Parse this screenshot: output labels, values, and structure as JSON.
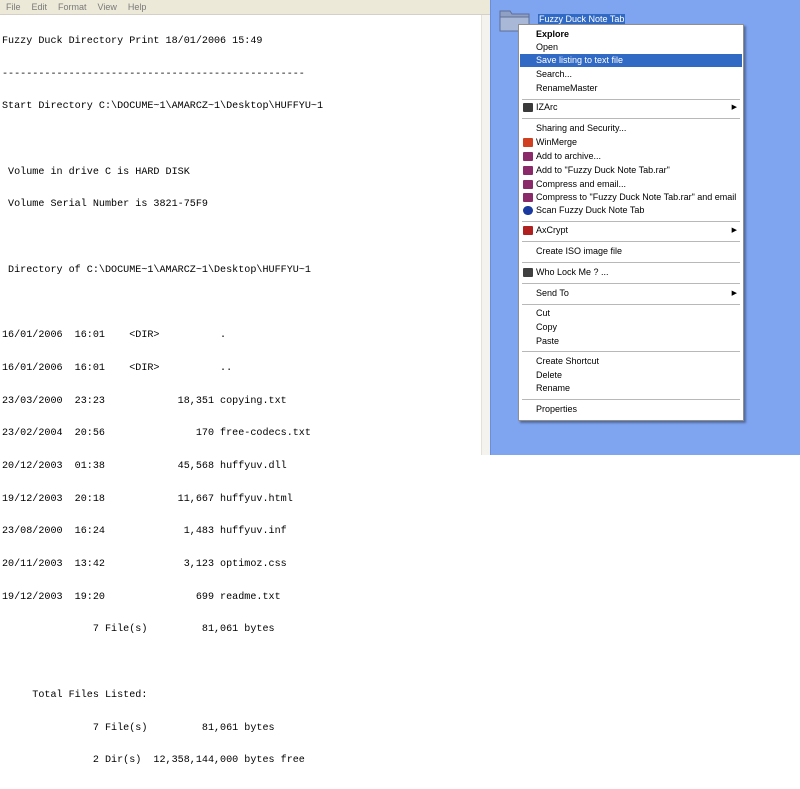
{
  "notepad": {
    "menu": [
      "File",
      "Edit",
      "Format",
      "View",
      "Help"
    ],
    "lines": [
      "Fuzzy Duck Directory Print 18/01/2006 15:49",
      "--------------------------------------------------",
      "Start Directory C:\\DOCUME~1\\AMARCZ~1\\Desktop\\HUFFYU~1",
      "",
      " Volume in drive C is HARD DISK",
      " Volume Serial Number is 3821-75F9",
      "",
      " Directory of C:\\DOCUME~1\\AMARCZ~1\\Desktop\\HUFFYU~1",
      "",
      "16/01/2006  16:01    <DIR>          .",
      "16/01/2006  16:01    <DIR>          ..",
      "23/03/2000  23:23            18,351 copying.txt",
      "23/02/2004  20:56               170 free-codecs.txt",
      "20/12/2003  01:38            45,568 huffyuv.dll",
      "19/12/2003  20:18            11,667 huffyuv.html",
      "23/08/2000  16:24             1,483 huffyuv.inf",
      "20/11/2003  13:42             3,123 optimoz.css",
      "19/12/2003  19:20               699 readme.txt",
      "               7 File(s)         81,061 bytes",
      "",
      "     Total Files Listed:",
      "               7 File(s)         81,061 bytes",
      "               2 Dir(s)  12,358,144,000 bytes free"
    ]
  },
  "desktop": {
    "folder_label": "Fuzzy Duck Note Tab"
  },
  "context_menu": {
    "explore": "Explore",
    "open": "Open",
    "save_listing": "Save listing to text file",
    "search": "Search...",
    "renamemaster": "RenameMaster",
    "izarc": "IZArc",
    "sharing": "Sharing and Security...",
    "winmerge": "WinMerge",
    "add_archive": "Add to archive...",
    "add_rar": "Add to \"Fuzzy Duck Note Tab.rar\"",
    "compress_email": "Compress and email...",
    "compress_rar_email": "Compress to \"Fuzzy Duck Note Tab.rar\" and email",
    "scan": "Scan Fuzzy Duck Note Tab",
    "axcrypt": "AxCrypt",
    "create_iso": "Create ISO image file",
    "who_lock": "Who Lock Me ? ...",
    "send_to": "Send To",
    "cut": "Cut",
    "copy": "Copy",
    "paste": "Paste",
    "create_shortcut": "Create Shortcut",
    "delete": "Delete",
    "rename": "Rename",
    "properties": "Properties",
    "highlight_color": "#316ac5",
    "desktop_color": "#7fa4f0"
  }
}
